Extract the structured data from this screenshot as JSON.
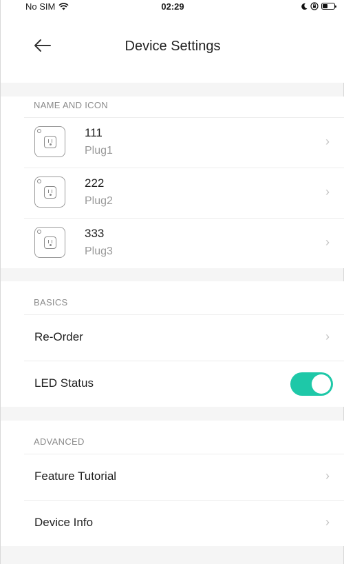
{
  "status_bar": {
    "carrier": "No SIM",
    "time": "02:29"
  },
  "header": {
    "title": "Device Settings",
    "back_icon": "arrow-left-icon"
  },
  "sections": {
    "name_and_icon": {
      "title": "NAME AND ICON",
      "devices": [
        {
          "name": "111",
          "model": "Plug1",
          "icon": "smart-plug-icon"
        },
        {
          "name": "222",
          "model": "Plug2",
          "icon": "smart-plug-icon"
        },
        {
          "name": "333",
          "model": "Plug3",
          "icon": "smart-plug-icon"
        }
      ]
    },
    "basics": {
      "title": "BASICS",
      "reorder_label": "Re-Order",
      "led_label": "LED Status",
      "led_on": true
    },
    "advanced": {
      "title": "ADVANCED",
      "tutorial_label": "Feature Tutorial",
      "device_info_label": "Device Info"
    }
  },
  "colors": {
    "accent": "#1ec8a8",
    "secondary_text": "#9a9a9a",
    "background": "#f5f5f5"
  }
}
